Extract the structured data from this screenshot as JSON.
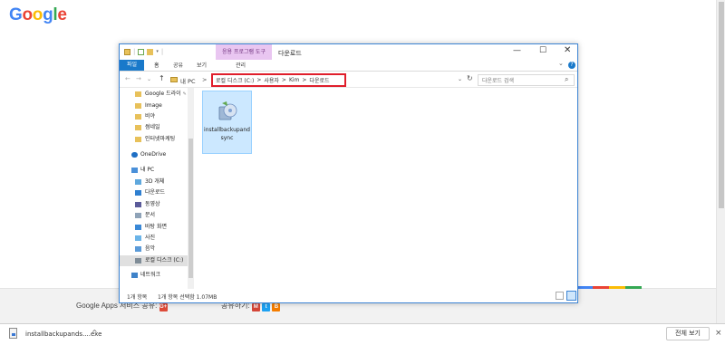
{
  "google_logo": {
    "letters": [
      "G",
      "o",
      "o",
      "g",
      "l",
      "e"
    ],
    "colors": [
      "#4285F4",
      "#EA4335",
      "#FBBC05",
      "#4285F4",
      "#34A853",
      "#EA4335"
    ]
  },
  "explorer": {
    "title": "다운로드",
    "context_tab": "응용 프로그램 도구",
    "ribbon_tabs": [
      "파일",
      "홈",
      "공유",
      "보기",
      "관리"
    ],
    "address": {
      "root": "내 PC",
      "path": [
        "로컬 디스크 (C:)",
        "사용자",
        "Kim",
        "다운로드"
      ],
      "separator": ">"
    },
    "search": {
      "placeholder": "다운로드 검색"
    },
    "nav_pane": [
      {
        "label": "Google 드라이",
        "icon": "folder-icon",
        "pinned": true
      },
      {
        "label": "Image",
        "icon": "folder-icon"
      },
      {
        "label": "비야",
        "icon": "folder-icon"
      },
      {
        "label": "썸네일",
        "icon": "folder-icon"
      },
      {
        "label": "인터넷마케팅",
        "icon": "folder-icon"
      },
      {
        "label": "OneDrive",
        "icon": "cloud-icon"
      },
      {
        "label": "내 PC",
        "icon": "computer-icon"
      },
      {
        "label": "3D 개체",
        "icon": "3d-objects-icon"
      },
      {
        "label": "다운로드",
        "icon": "downloads-icon"
      },
      {
        "label": "동영상",
        "icon": "videos-icon"
      },
      {
        "label": "문서",
        "icon": "documents-icon"
      },
      {
        "label": "바탕 화면",
        "icon": "desktop-icon"
      },
      {
        "label": "사진",
        "icon": "pictures-icon"
      },
      {
        "label": "음악",
        "icon": "music-icon"
      },
      {
        "label": "로컬 디스크 (C:)",
        "icon": "drive-icon",
        "selected": true
      },
      {
        "label": "네트워크",
        "icon": "network-icon"
      }
    ],
    "files": [
      {
        "name": "installbackupandsync",
        "icon": "installer-icon",
        "selected": true
      }
    ],
    "status": {
      "count": "1개 항목",
      "selection": "1개 항목 선택함 1.07MB"
    }
  },
  "footer": {
    "apps_text": "Google Apps",
    "apps_text_partial": "서비스 공유:",
    "share_text_partial": "공유하기:",
    "color_bar": [
      "#4285F4",
      "#EA4335",
      "#FBBC05",
      "#34A853"
    ]
  },
  "download_bar": {
    "filename": "installbackupands....exe",
    "show_all": "전체 보기"
  }
}
